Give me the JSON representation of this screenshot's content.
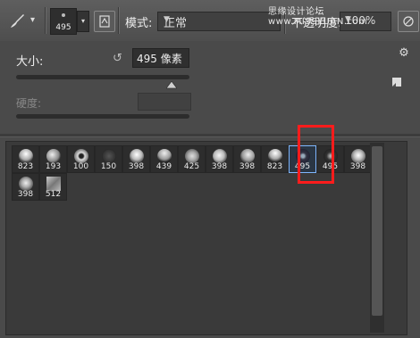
{
  "toolbar": {
    "brush_preset_size": "495",
    "mode_label": "模式:",
    "mode_value": "正常",
    "opacity_label": "不透明度:",
    "opacity_value": "100%",
    "watermark": "思缘设计论坛 www.MISSYUAN.com"
  },
  "picker": {
    "size_label": "大小:",
    "size_value": "495 像素",
    "size_slider_fraction": 0.95,
    "hardness_label": "硬度:"
  },
  "presets": [
    {
      "size": "823"
    },
    {
      "size": "193"
    },
    {
      "size": "100"
    },
    {
      "size": "150"
    },
    {
      "size": "398"
    },
    {
      "size": "439"
    },
    {
      "size": "425"
    },
    {
      "size": "398"
    },
    {
      "size": "398"
    },
    {
      "size": "823"
    },
    {
      "size": "495",
      "selected": true
    },
    {
      "size": "495"
    },
    {
      "size": "398"
    },
    {
      "size": "398"
    },
    {
      "size": "512"
    }
  ],
  "colors": {
    "highlight": "#ff1c1c",
    "selection": "#7eb6ff"
  },
  "icons": [
    "brush-tool-icon",
    "brush-panel-icon",
    "reset-icon",
    "gear-icon",
    "new-preset-icon",
    "pressure-icon"
  ]
}
